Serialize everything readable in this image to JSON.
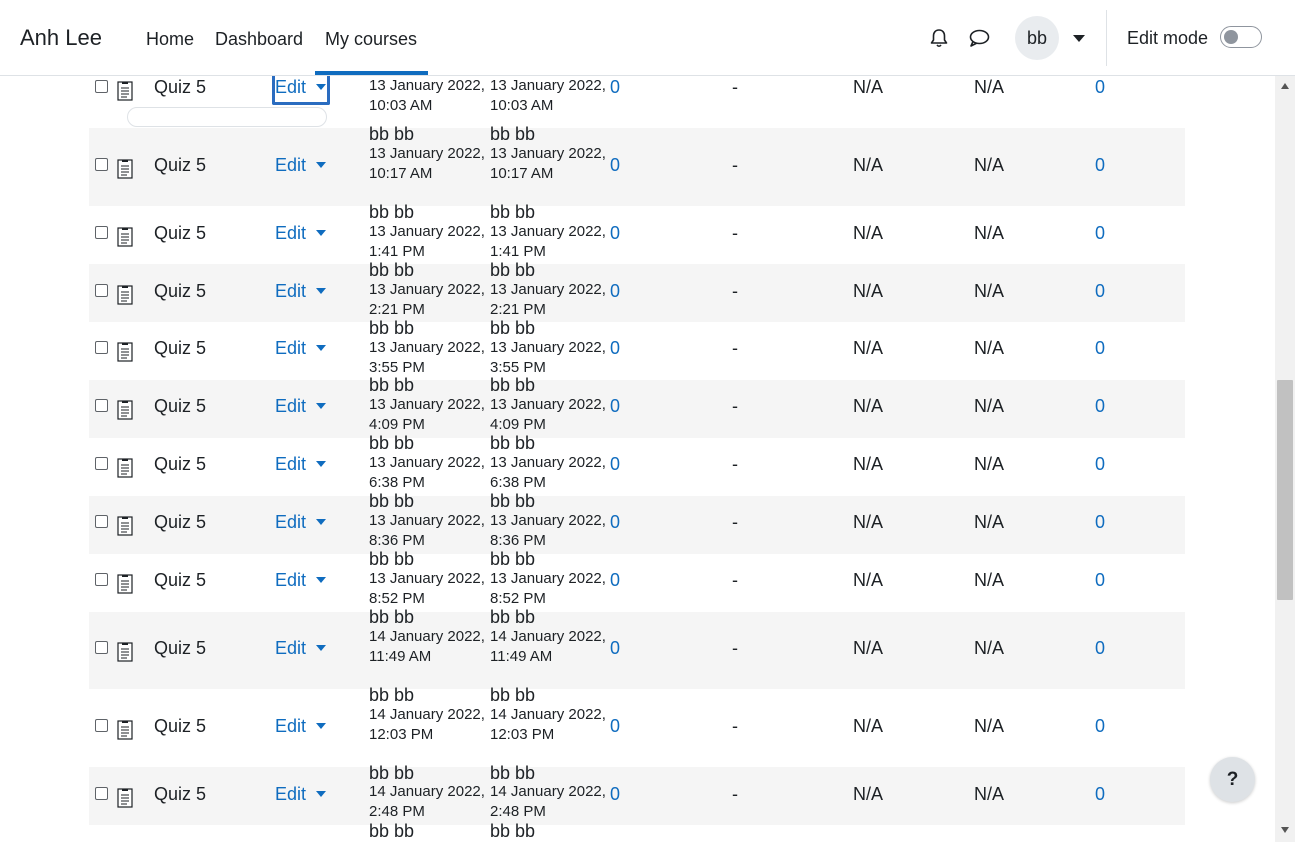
{
  "navbar": {
    "brand": "Anh Lee",
    "links": [
      "Home",
      "Dashboard",
      "My courses"
    ],
    "active_link": "My courses",
    "avatar_initials": "bb",
    "edit_mode_label": "Edit mode",
    "edit_mode_on": false
  },
  "icons": {
    "notifications": "bell-icon",
    "messages": "chat-bubble-icon",
    "user_menu": "caret-down-icon",
    "quiz_item": "quiz-icon",
    "help": "question-mark"
  },
  "colors": {
    "link": "#0f6cbf",
    "row_stripe": "#f5f5f5"
  },
  "table": {
    "edit_label": "Edit",
    "rows": [
      {
        "name": "Quiz 5",
        "modified_by": "",
        "created": "13 January 2022, 10:03 AM",
        "modified": "13 January 2022, 10:03 AM",
        "c1": "0",
        "c2": "-",
        "c3": "N/A",
        "c4": "N/A",
        "c5": "0"
      },
      {
        "name": "Quiz 5",
        "modified_by": "bb bb",
        "created": "13 January 2022, 10:17 AM",
        "modified": "13 January 2022, 10:17 AM",
        "c1": "0",
        "c2": "-",
        "c3": "N/A",
        "c4": "N/A",
        "c5": "0"
      },
      {
        "name": "Quiz 5",
        "modified_by": "bb bb",
        "created": "13 January 2022, 1:41 PM",
        "modified": "13 January 2022, 1:41 PM",
        "c1": "0",
        "c2": "-",
        "c3": "N/A",
        "c4": "N/A",
        "c5": "0"
      },
      {
        "name": "Quiz 5",
        "modified_by": "bb bb",
        "created": "13 January 2022, 2:21 PM",
        "modified": "13 January 2022, 2:21 PM",
        "c1": "0",
        "c2": "-",
        "c3": "N/A",
        "c4": "N/A",
        "c5": "0"
      },
      {
        "name": "Quiz 5",
        "modified_by": "bb bb",
        "created": "13 January 2022, 3:55 PM",
        "modified": "13 January 2022, 3:55 PM",
        "c1": "0",
        "c2": "-",
        "c3": "N/A",
        "c4": "N/A",
        "c5": "0"
      },
      {
        "name": "Quiz 5",
        "modified_by": "bb bb",
        "created": "13 January 2022, 4:09 PM",
        "modified": "13 January 2022, 4:09 PM",
        "c1": "0",
        "c2": "-",
        "c3": "N/A",
        "c4": "N/A",
        "c5": "0"
      },
      {
        "name": "Quiz 5",
        "modified_by": "bb bb",
        "created": "13 January 2022, 6:38 PM",
        "modified": "13 January 2022, 6:38 PM",
        "c1": "0",
        "c2": "-",
        "c3": "N/A",
        "c4": "N/A",
        "c5": "0"
      },
      {
        "name": "Quiz 5",
        "modified_by": "bb bb",
        "created": "13 January 2022, 8:36 PM",
        "modified": "13 January 2022, 8:36 PM",
        "c1": "0",
        "c2": "-",
        "c3": "N/A",
        "c4": "N/A",
        "c5": "0"
      },
      {
        "name": "Quiz 5",
        "modified_by": "bb bb",
        "created": "13 January 2022, 8:52 PM",
        "modified": "13 January 2022, 8:52 PM",
        "c1": "0",
        "c2": "-",
        "c3": "N/A",
        "c4": "N/A",
        "c5": "0"
      },
      {
        "name": "Quiz 5",
        "modified_by": "bb bb",
        "created": "14 January 2022, 11:49 AM",
        "modified": "14 January 2022, 11:49 AM",
        "c1": "0",
        "c2": "-",
        "c3": "N/A",
        "c4": "N/A",
        "c5": "0"
      },
      {
        "name": "Quiz 5",
        "modified_by": "bb bb",
        "created": "14 January 2022, 12:03 PM",
        "modified": "14 January 2022, 12:03 PM",
        "c1": "0",
        "c2": "-",
        "c3": "N/A",
        "c4": "N/A",
        "c5": "0"
      },
      {
        "name": "Quiz 5",
        "modified_by": "bb bb",
        "created": "14 January 2022, 2:48 PM",
        "modified": "14 January 2022, 2:48 PM",
        "c1": "0",
        "c2": "-",
        "c3": "N/A",
        "c4": "N/A",
        "c5": "0"
      },
      {
        "name": "",
        "modified_by": "bb bb",
        "created": "",
        "modified": "",
        "c1": "",
        "c2": "",
        "c3": "",
        "c4": "",
        "c5": ""
      }
    ]
  },
  "help_button": "?"
}
